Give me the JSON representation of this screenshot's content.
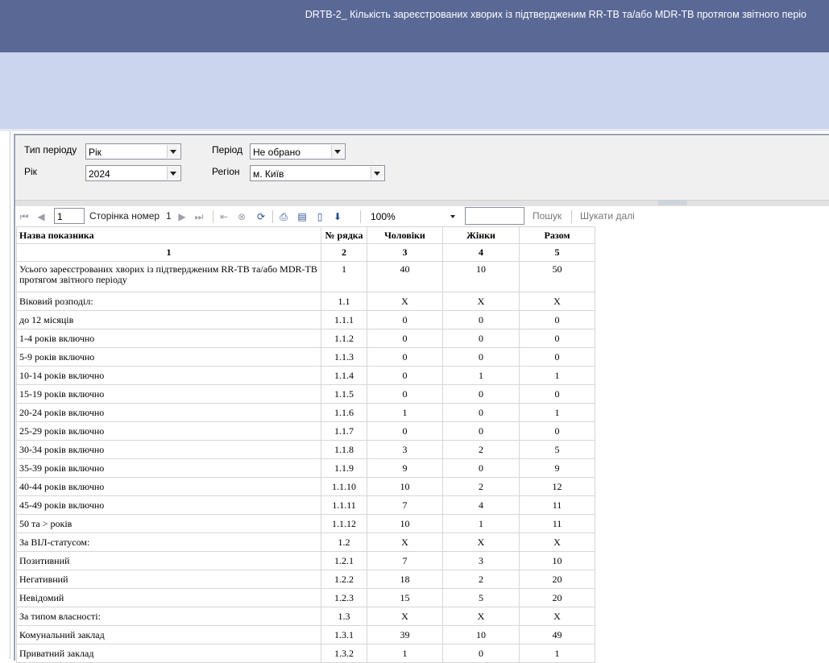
{
  "window": {
    "title": "DRTB-2_ Кількість зареєстрованих хворих із підтвердженим RR-TB та/або MDR-TB протягом звітного періо"
  },
  "params": {
    "period_type_label": "Тип періоду",
    "period_type_value": "Рік",
    "year_label": "Рік",
    "year_value": "2024",
    "period_label": "Період",
    "period_value": "Не обрано",
    "region_label": "Регіон",
    "region_value": "м. Київ"
  },
  "toolbar": {
    "page_input": "1",
    "page_label": "Сторінка номер",
    "page_value": "1",
    "zoom": "100%",
    "search_label": "Пошук",
    "find_next_label": "Шукати далі"
  },
  "table": {
    "headers": [
      "Назва показника",
      "№ рядка",
      "Чоловіки",
      "Жінки",
      "Разом"
    ],
    "col_numbers": [
      "1",
      "2",
      "3",
      "4",
      "5"
    ],
    "rows": [
      [
        "Усього зареєстрованих хворих із підтвердженим RR-TB та/або MDR-TB протягом звітного періоду",
        "1",
        "40",
        "10",
        "50"
      ],
      [
        "Віковий розподіл:",
        "1.1",
        "X",
        "X",
        "X"
      ],
      [
        "до 12 місяців",
        "1.1.1",
        "0",
        "0",
        "0"
      ],
      [
        "1-4 років включно",
        "1.1.2",
        "0",
        "0",
        "0"
      ],
      [
        "5-9 років включно",
        "1.1.3",
        "0",
        "0",
        "0"
      ],
      [
        "10-14 років включно",
        "1.1.4",
        "0",
        "1",
        "1"
      ],
      [
        "15-19 років включно",
        "1.1.5",
        "0",
        "0",
        "0"
      ],
      [
        "20-24 років включно",
        "1.1.6",
        "1",
        "0",
        "1"
      ],
      [
        "25-29 років включно",
        "1.1.7",
        "0",
        "0",
        "0"
      ],
      [
        "30-34 років включно",
        "1.1.8",
        "3",
        "2",
        "5"
      ],
      [
        "35-39 років включно",
        "1.1.9",
        "9",
        "0",
        "9"
      ],
      [
        "40-44 років включно",
        "1.1.10",
        "10",
        "2",
        "12"
      ],
      [
        "45-49 років включно",
        "1.1.11",
        "7",
        "4",
        "11"
      ],
      [
        "50 та > років",
        "1.1.12",
        "10",
        "1",
        "11"
      ],
      [
        "За ВІЛ-статусом:",
        "1.2",
        "X",
        "X",
        "X"
      ],
      [
        "Позитивний",
        "1.2.1",
        "7",
        "3",
        "10"
      ],
      [
        "Негативний",
        "1.2.2",
        "18",
        "2",
        "20"
      ],
      [
        "Невідомий",
        "1.2.3",
        "15",
        "5",
        "20"
      ],
      [
        "За типом власності:",
        "1.3",
        "X",
        "X",
        "X"
      ],
      [
        "Комунальний заклад",
        "1.3.1",
        "39",
        "10",
        "49"
      ],
      [
        "Приватний заклад",
        "1.3.2",
        "1",
        "0",
        "1"
      ]
    ]
  }
}
